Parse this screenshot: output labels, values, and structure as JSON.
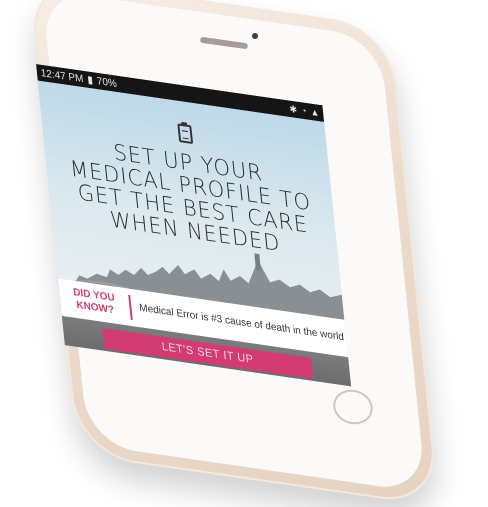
{
  "status_bar": {
    "time": "12:47 PM",
    "battery": "70%",
    "icons": [
      "signal-icon",
      "wifi-icon",
      "bluetooth-icon",
      "notification-icons"
    ]
  },
  "hero": {
    "icon": "clipboard-icon",
    "headline": "SET UP YOUR MEDICAL PROFILE TO GET THE BEST CARE WHEN NEEDED"
  },
  "fact": {
    "label": "DID YOU KNOW?",
    "text": "Medical Error is #3 cause of death in the world"
  },
  "cta": {
    "label": "LET'S SET IT UP"
  },
  "colors": {
    "accent": "#d23c73",
    "sky_top": "#bed9e8",
    "status_bar_bg": "#151515"
  }
}
